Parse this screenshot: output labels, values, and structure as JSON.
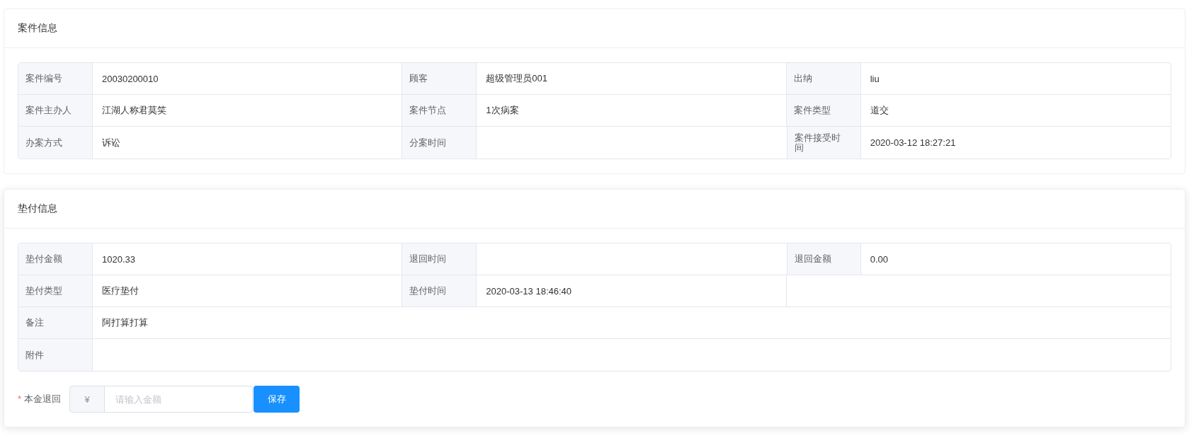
{
  "sections": [
    {
      "title": "案件信息",
      "rows": [
        [
          {
            "label": "案件编号",
            "value": "20030200010"
          },
          {
            "label": "顾客",
            "value": "超级管理员001"
          },
          {
            "label": "出纳",
            "value": "liu"
          }
        ],
        [
          {
            "label": "案件主办人",
            "value": "江湖人称君莫笑"
          },
          {
            "label": "案件节点",
            "value": "1次病案"
          },
          {
            "label": "案件类型",
            "value": "道交"
          }
        ],
        [
          {
            "label": "办案方式",
            "value": "诉讼"
          },
          {
            "label": "分案时间"
          },
          {
            "label": "案件接受时间",
            "value": "2020-03-12 18:27:21"
          }
        ]
      ]
    },
    {
      "title": "垫付信息",
      "rows": [
        [
          {
            "label": "垫付金额",
            "value": "1020.33"
          },
          {
            "label": "退回时间"
          },
          {
            "label": "退回金额",
            "value": "0.00"
          }
        ],
        [
          {
            "label": "垫付类型",
            "value": "医疗垫付"
          },
          {
            "label": "垫付时间",
            "value": "2020-03-13 18:46:40"
          }
        ],
        [
          {
            "label": "备注",
            "value": "阿打算打算"
          }
        ],
        [
          {
            "label": "附件"
          }
        ]
      ],
      "form": {
        "required_mark": "*",
        "label": "本金退回",
        "prefix": "¥",
        "placeholder": "请输入金额",
        "button": "保存"
      }
    }
  ]
}
